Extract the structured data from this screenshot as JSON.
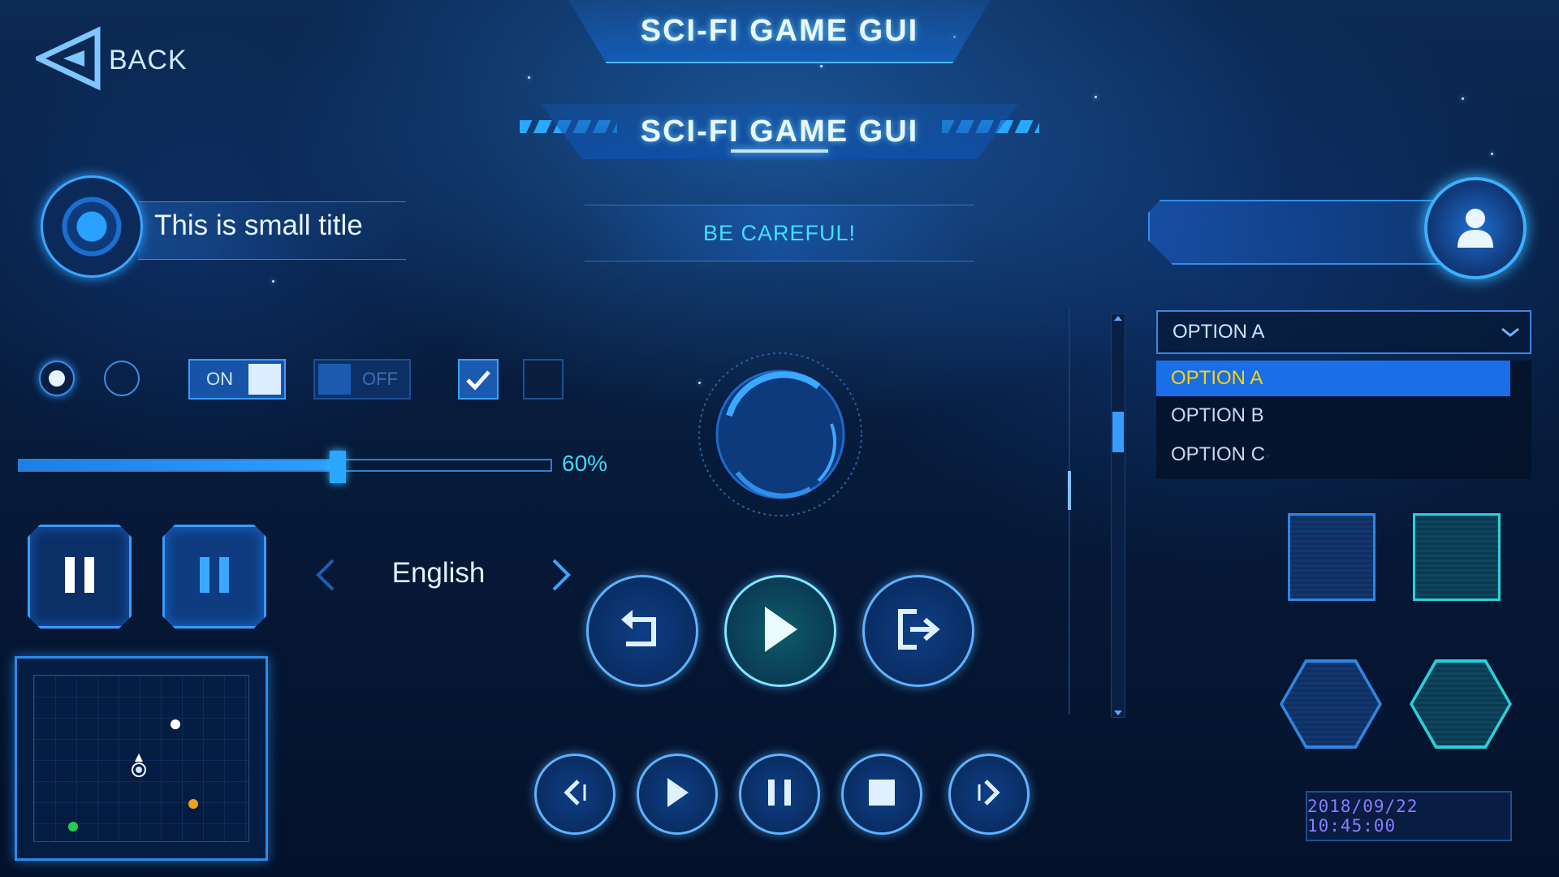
{
  "header": {
    "title_top": "SCI-FI GAME GUI",
    "title_main": "SCI-FI GAME GUI"
  },
  "back": {
    "label": "BACK"
  },
  "small_title": {
    "text": "This is small title"
  },
  "warning": {
    "text": "BE CAREFUL!"
  },
  "toggles": {
    "on_label": "ON",
    "off_label": "OFF",
    "on_state": true,
    "off_state": false
  },
  "radios": {
    "selected_index": 0
  },
  "checkboxes": {
    "first_checked": true,
    "second_checked": false
  },
  "slider": {
    "value_percent": 60,
    "label": "60%"
  },
  "language": {
    "value": "English"
  },
  "dropdown": {
    "selected": "OPTION A",
    "options": [
      "OPTION A",
      "OPTION B",
      "OPTION C"
    ]
  },
  "datetime": {
    "text": "2018/09/22 10:45:00"
  },
  "scrollbar": {
    "position_fraction": 0.3
  },
  "minimap": {
    "markers": [
      {
        "color": "#ffffff",
        "kind": "white-dot"
      },
      {
        "color": "#f0a020",
        "kind": "orange-dot"
      },
      {
        "color": "#22cc55",
        "kind": "green-dot"
      },
      {
        "color": "#ffffff",
        "kind": "player-marker"
      }
    ]
  },
  "colors": {
    "accent": "#2aa8ff",
    "warning": "#3fe0ff",
    "highlight_option": "#1a6ee8",
    "highlight_option_text": "#ffd400",
    "datetime_text": "#8a7dff"
  },
  "icons": {
    "back": "back-arrow-icon",
    "avatar": "user-avatar-icon",
    "check": "check-icon",
    "dropdown": "chevron-down-icon",
    "pause": "pause-icon",
    "undo": "undo-icon",
    "play": "play-icon",
    "exit": "exit-icon",
    "previous": "previous-icon",
    "stop": "stop-icon",
    "next": "next-icon"
  }
}
